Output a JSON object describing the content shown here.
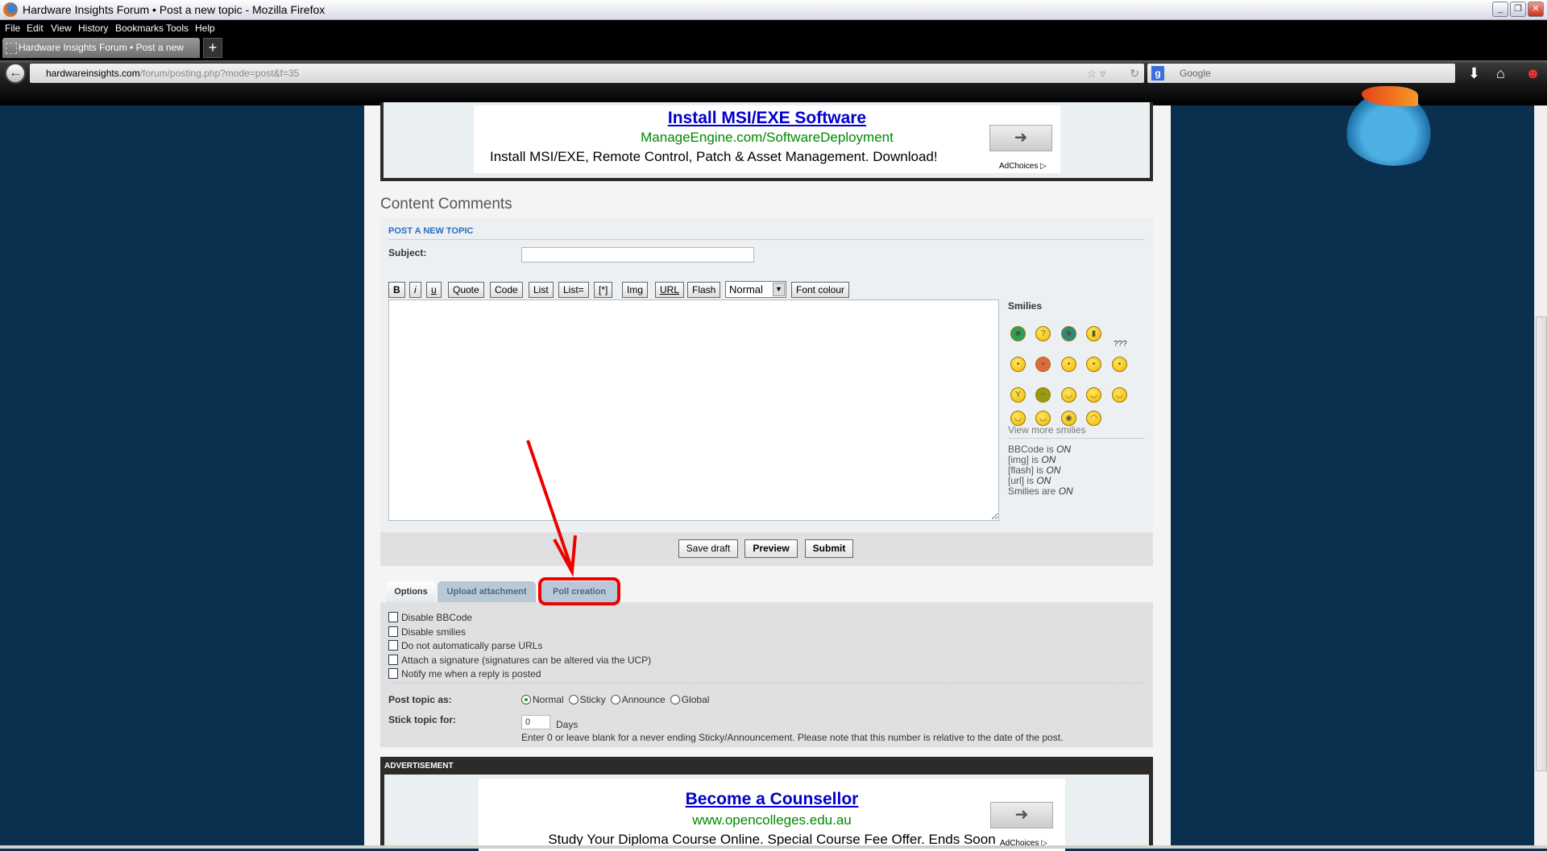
{
  "window": {
    "title": "Hardware Insights Forum • Post a new topic - Mozilla Firefox"
  },
  "menu": [
    "File",
    "Edit",
    "View",
    "History",
    "Bookmarks",
    "Tools",
    "Help"
  ],
  "tabs": [
    {
      "label": "Hardware Insights Forum • Post a new topic"
    }
  ],
  "new_tab": "+",
  "address": {
    "domain": "hardwareinsights.com",
    "path": "/forum/posting.php?mode=post&f=35"
  },
  "search": {
    "placeholder": "Google"
  },
  "ad_top": {
    "title": "Install MSI/EXE Software",
    "url": "ManageEngine.com/SoftwareDeployment",
    "desc": "Install MSI/EXE, Remote Control, Patch & Asset Management. Download!",
    "adchoices": "AdChoices"
  },
  "page": {
    "heading": "Content Comments",
    "panel_title": "POST A NEW TOPIC",
    "subject_label": "Subject:",
    "subject_value": ""
  },
  "toolbar": {
    "buttons": [
      "B",
      "i",
      "u",
      "Quote",
      "Code",
      "List",
      "List=",
      "[*]",
      "Img",
      "URL",
      "Flash"
    ],
    "font_size": "Normal",
    "font_colour": "Font colour"
  },
  "smilies": {
    "title": "Smilies",
    "items": [
      "very-happy",
      "help",
      "sick",
      "wall",
      "confused",
      "mad",
      "blush",
      "rolleyes",
      "question",
      "cheer",
      "drunk",
      "smile-closed",
      "wink-think",
      "smile",
      "grin",
      "tongue",
      "geek",
      "sad"
    ],
    "question_marks": "???",
    "view_more": "View more smilies"
  },
  "status_lines": [
    {
      "pre": "BBCode is ",
      "val": "ON"
    },
    {
      "pre": "[img] is ",
      "val": "ON"
    },
    {
      "pre": "[flash] is ",
      "val": "ON"
    },
    {
      "pre": "[url] is ",
      "val": "ON"
    },
    {
      "pre": "Smilies are ",
      "val": "ON"
    }
  ],
  "actions": {
    "save_draft": "Save draft",
    "preview": "Preview",
    "submit": "Submit"
  },
  "option_tabs": [
    "Options",
    "Upload attachment",
    "Poll creation"
  ],
  "options": {
    "checkboxes": [
      "Disable BBCode",
      "Disable smilies",
      "Do not automatically parse URLs",
      "Attach a signature (signatures can be altered via the UCP)",
      "Notify me when a reply is posted"
    ],
    "post_topic_label": "Post topic as:",
    "post_types": [
      "Normal",
      "Sticky",
      "Announce",
      "Global"
    ],
    "selected_type": "Normal",
    "stick_label": "Stick topic for:",
    "stick_value": "0",
    "stick_unit": "Days",
    "stick_note": "Enter 0 or leave blank for a never ending Sticky/Announcement. Please note that this number is relative to the date of the post."
  },
  "ad_bottom": {
    "header": "ADVERTISEMENT",
    "title": "Become a Counsellor",
    "url": "www.opencolleges.edu.au",
    "desc": "Study Your Diploma Course Online. Special Course Fee Offer. Ends Soon",
    "adchoices": "AdChoices"
  },
  "colors": {
    "page_bg": "#0b2f4e",
    "link": "#2a6ebb",
    "annotation": "#ee0000"
  }
}
